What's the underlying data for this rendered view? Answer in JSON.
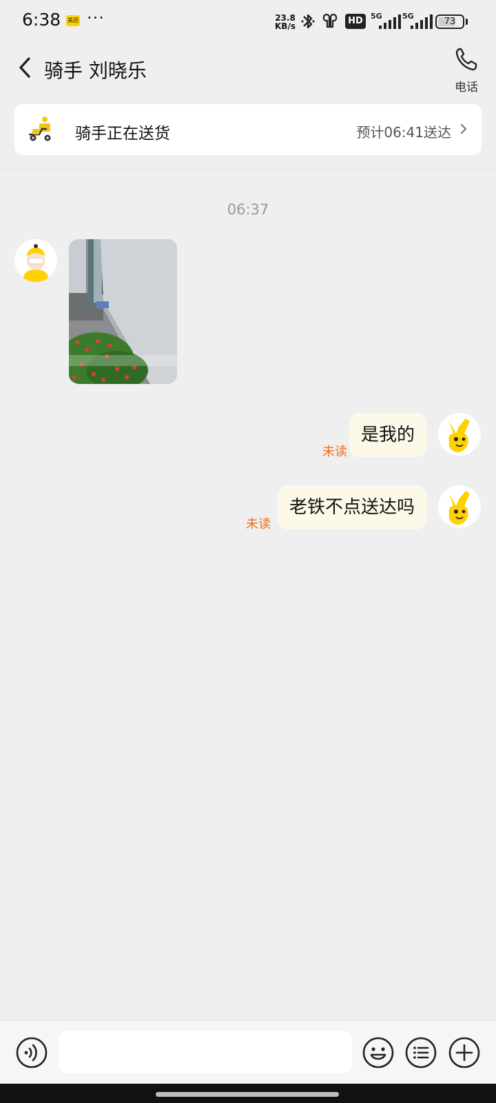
{
  "status_bar": {
    "time": "6:38",
    "app_badge": "美团",
    "more": "···",
    "net_speed_value": "23.8",
    "net_speed_unit": "KB/s",
    "hd_label": "HD",
    "sim1_label": "5G",
    "sim2_label": "5G",
    "battery": "73",
    "battery_level_percent": 73
  },
  "header": {
    "title": "骑手 刘晓乐",
    "phone_label": "电话"
  },
  "delivery_card": {
    "status": "骑手正在送货",
    "eta": "预计06:41送达",
    "accent": "#f5c518"
  },
  "conversation": {
    "timestamp": "06:37",
    "messages": [
      {
        "from": "rider",
        "type": "image"
      },
      {
        "from": "me",
        "type": "text",
        "text": "是我的",
        "read_status": "未读"
      },
      {
        "from": "me",
        "type": "text",
        "text": "老铁不点送达吗",
        "read_status": "未读"
      }
    ]
  },
  "input_bar": {
    "voice_icon": "voice-icon",
    "emoji_icon": "emoji-icon",
    "quick_reply_icon": "list-icon",
    "more_icon": "plus-icon",
    "placeholder": ""
  },
  "colors": {
    "background": "#efefef",
    "bubble_me": "#fdf9e8",
    "unread": "#f06c1b",
    "brand_yellow": "#ffd100"
  }
}
